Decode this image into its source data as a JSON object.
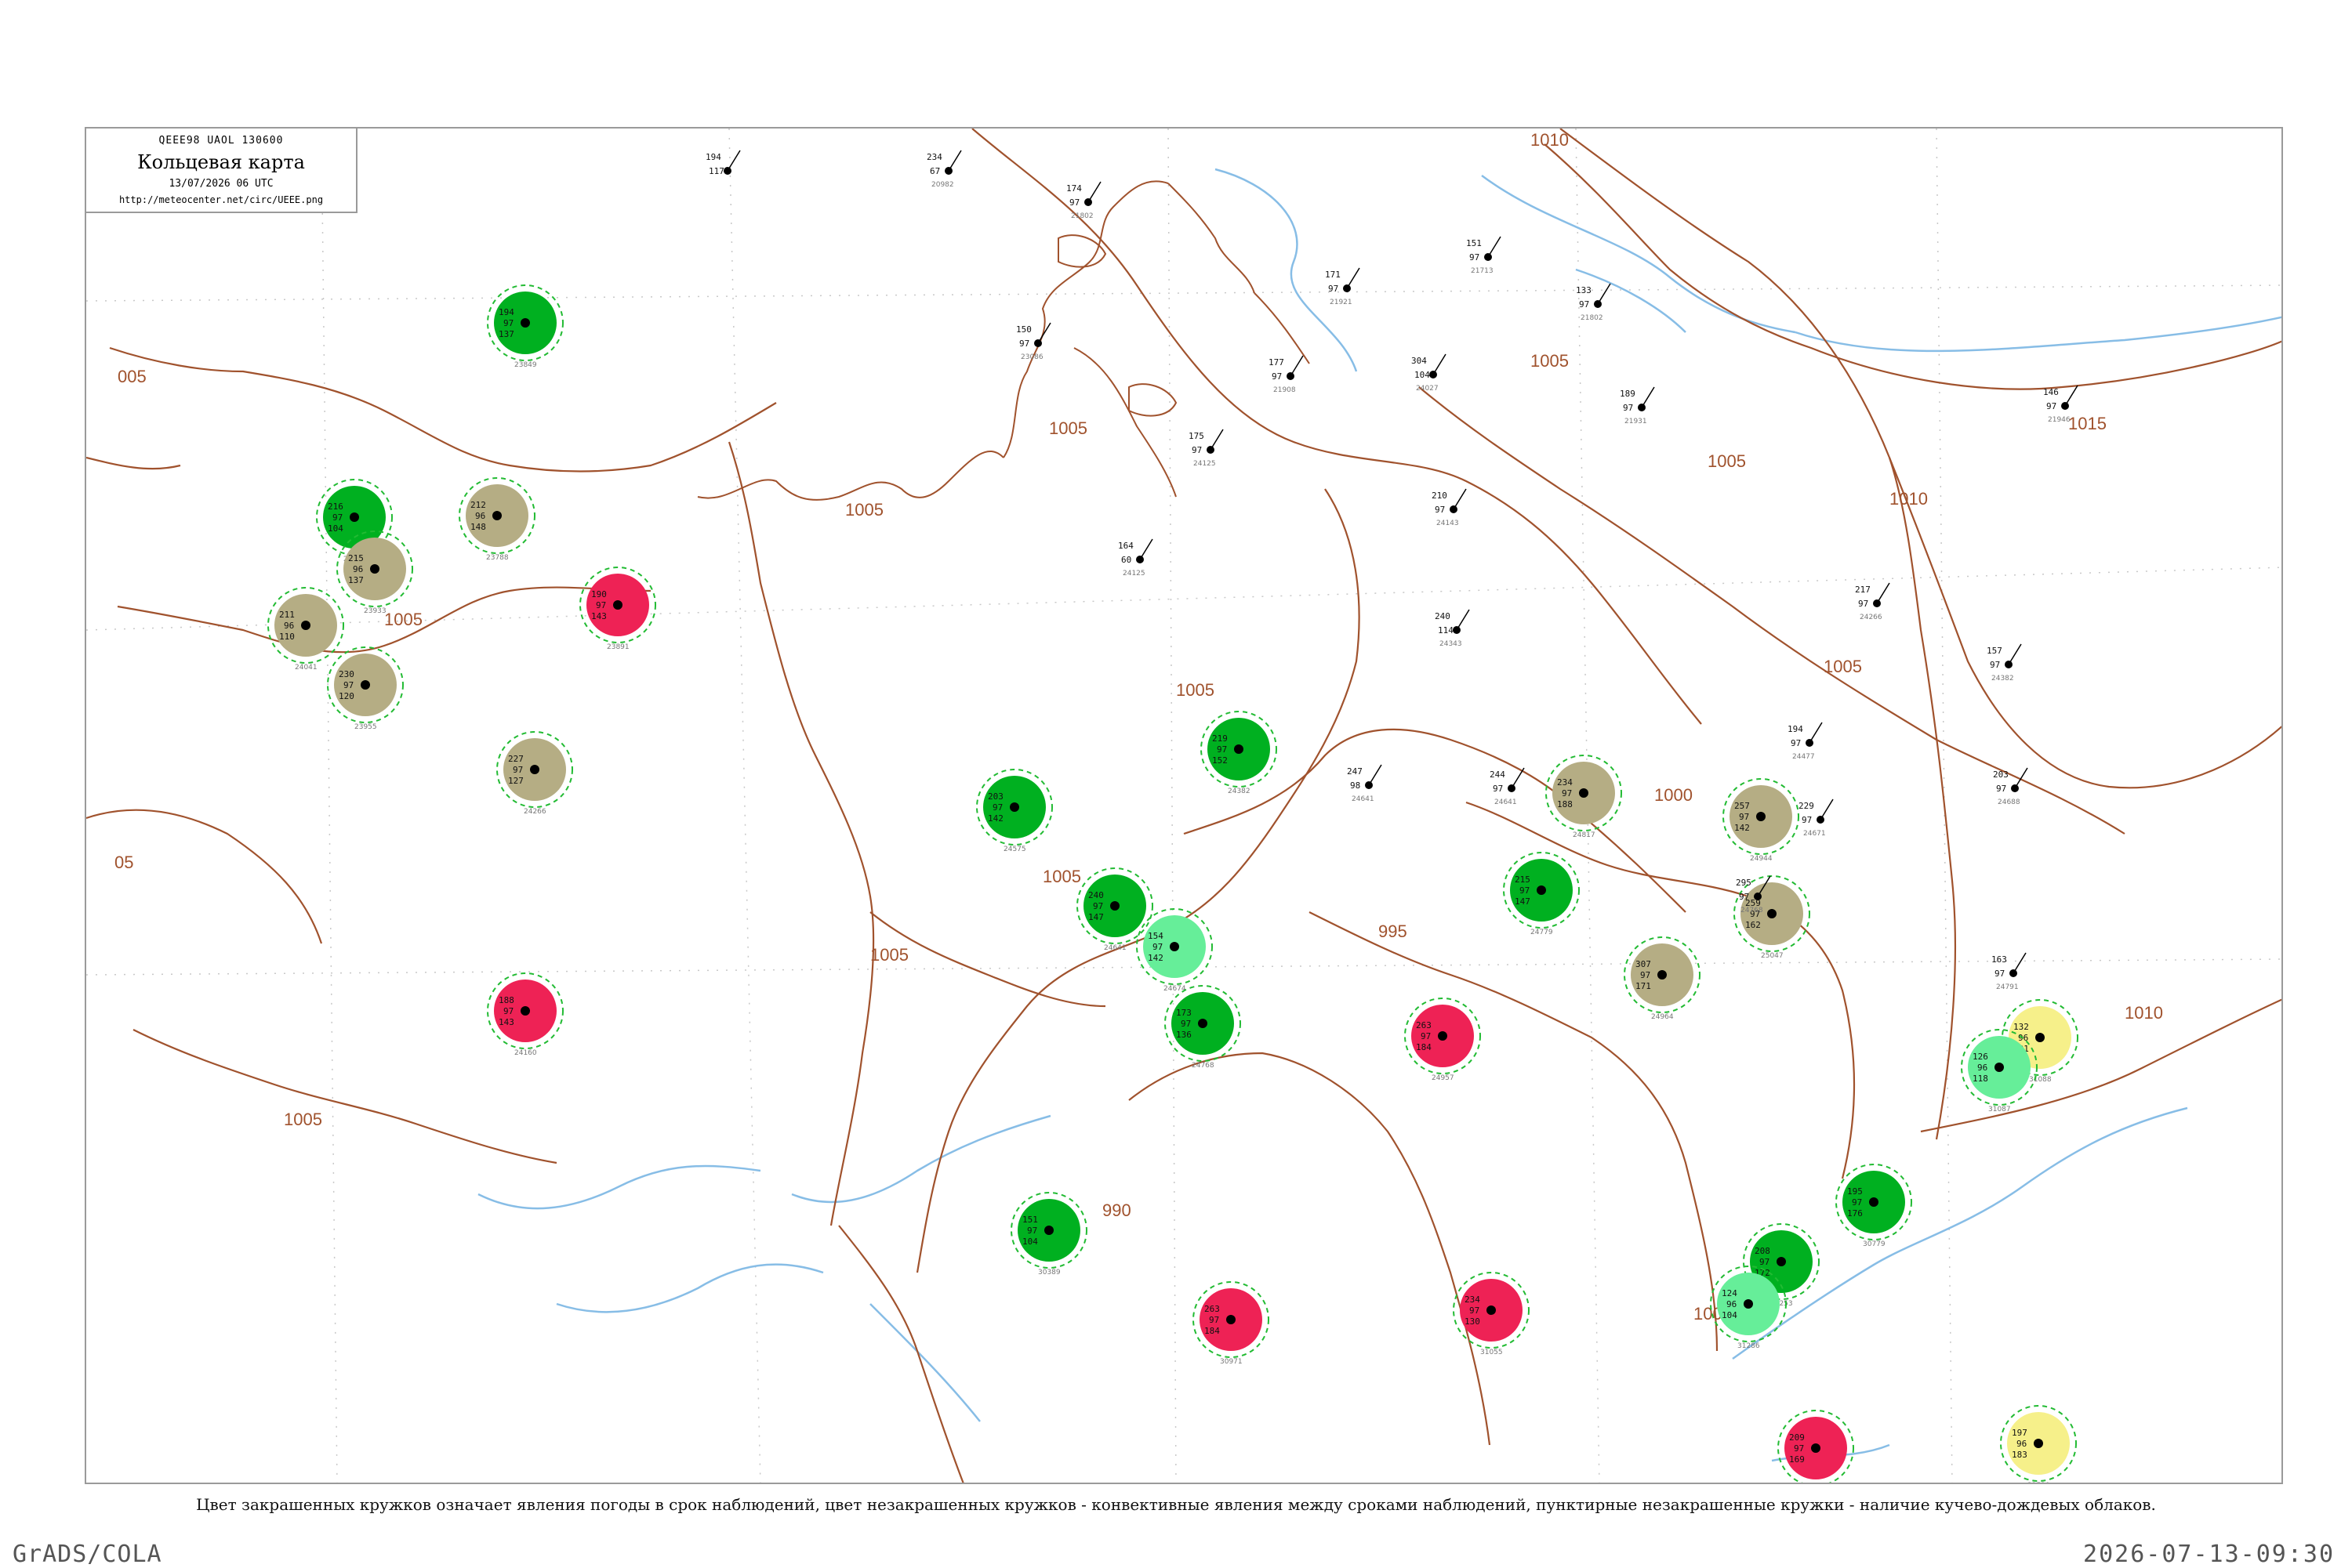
{
  "header": {
    "code": "QEEE98  UAOL  130600",
    "title": "Кольцевая карта",
    "date": "13/07/2026 06 UTC",
    "url": "http://meteocenter.net/circ/UEEE.png"
  },
  "caption": "Цвет закрашенных кружков означает явления погоды в срок наблюдений, цвет незакрашенных кружков - конвективные явления между сроками наблюдений, пунктирные незакрашенные кружки - наличие кучево-дождевых облаков.",
  "footer": {
    "left": "GrADS/COLA",
    "right": "2026-07-13-09:30"
  },
  "colors": {
    "isobar": "#a0522d",
    "coast": "#a0522d",
    "river": "#87bde6",
    "thunder_green": "#00b020",
    "shower_olive": "#b5ad84",
    "heavy_red": "#ee2255",
    "light_green": "#66ee99",
    "yellow": "#f6f08a",
    "cb_dash": "#22bb33"
  },
  "isobars": [
    {
      "label": "1010"
    },
    {
      "label": "1005"
    },
    {
      "label": "1005"
    },
    {
      "label": "1005"
    },
    {
      "label": "1005"
    },
    {
      "label": "1005"
    },
    {
      "label": "1005"
    },
    {
      "label": "1015"
    },
    {
      "label": "1010"
    },
    {
      "label": "1005"
    },
    {
      "label": "1000"
    },
    {
      "label": "995"
    },
    {
      "label": "990"
    },
    {
      "label": "1000"
    },
    {
      "label": "1010"
    },
    {
      "label": "1005"
    },
    {
      "label": "1005"
    },
    {
      "label": "1005"
    },
    {
      "label": "005"
    },
    {
      "label": "05"
    }
  ],
  "stations": [
    {
      "type": "green",
      "t": "194",
      "d": "97",
      "p": "137",
      "id": "23849"
    },
    {
      "type": "olive",
      "t": "212",
      "d": "96",
      "p": "148",
      "id": "23788"
    },
    {
      "type": "red",
      "t": "190",
      "d": "97",
      "p": "143",
      "id": "23891"
    },
    {
      "type": "green",
      "t": "216",
      "d": "97",
      "p": "104",
      "id": "23946"
    },
    {
      "type": "olive",
      "t": "215",
      "d": "96",
      "p": "137",
      "id": "23933"
    },
    {
      "type": "olive",
      "t": "211",
      "d": "96",
      "p": "110",
      "id": "24041"
    },
    {
      "type": "olive",
      "t": "230",
      "d": "97",
      "p": "120",
      "id": "23955"
    },
    {
      "type": "red",
      "t": "188",
      "d": "97",
      "p": "143",
      "id": "24160"
    },
    {
      "type": "olive",
      "t": "227",
      "d": "97",
      "p": "127",
      "id": "24266"
    },
    {
      "type": "green",
      "t": "219",
      "d": "97",
      "p": "152",
      "id": "24382"
    },
    {
      "type": "green",
      "t": "203",
      "d": "97",
      "p": "142",
      "id": "24575"
    },
    {
      "type": "green",
      "t": "240",
      "d": "97",
      "p": "147",
      "id": "24641"
    },
    {
      "type": "lightgreen",
      "t": "154",
      "d": "97",
      "p": "142",
      "id": "24674"
    },
    {
      "type": "green",
      "t": "173",
      "d": "97",
      "p": "136",
      "id": "24768"
    },
    {
      "type": "red",
      "t": "263",
      "d": "97",
      "p": "184",
      "id": "24957"
    },
    {
      "type": "olive",
      "t": "234",
      "d": "97",
      "p": "188",
      "id": "24817"
    },
    {
      "type": "olive",
      "t": "257",
      "d": "97",
      "p": "142",
      "id": "24944"
    },
    {
      "type": "olive",
      "t": "259",
      "d": "97",
      "p": "162",
      "id": "25047"
    },
    {
      "type": "green",
      "t": "215",
      "d": "97",
      "p": "147",
      "id": "24779"
    },
    {
      "type": "green",
      "t": "208",
      "d": "97",
      "p": "172",
      "id": "30253"
    },
    {
      "type": "red",
      "t": "209",
      "d": "97",
      "p": "169",
      "id": "31036"
    },
    {
      "type": "yellow",
      "t": "132",
      "d": "96",
      "p": "131",
      "id": "31088"
    },
    {
      "type": "lightgreen",
      "t": "126",
      "d": "96",
      "p": "118",
      "id": "31087"
    },
    {
      "type": "yellow",
      "t": "197",
      "d": "96",
      "p": "183",
      "id": "31510"
    },
    {
      "type": "green",
      "t": "195",
      "d": "97",
      "p": "176",
      "id": "30779"
    },
    {
      "type": "lightgreen",
      "t": "124",
      "d": "96",
      "p": "104",
      "id": "31286"
    },
    {
      "type": "red",
      "t": "263",
      "d": "97",
      "p": "184",
      "id": "30971"
    },
    {
      "type": "red",
      "t": "234",
      "d": "97",
      "p": "130",
      "id": "31055"
    },
    {
      "type": "green",
      "t": "151",
      "d": "97",
      "p": "104",
      "id": "30389"
    },
    {
      "type": "olive",
      "t": "307",
      "d": "97",
      "p": "171",
      "id": "24964"
    }
  ],
  "plain_stations": [
    {
      "t": "194",
      "d": "117",
      "id": ""
    },
    {
      "t": "234",
      "d": "67",
      "id": "20982"
    },
    {
      "t": "174",
      "d": "97",
      "id": "21802"
    },
    {
      "t": "171",
      "d": "97",
      "id": "21921"
    },
    {
      "t": "151",
      "d": "97",
      "id": "21713"
    },
    {
      "t": "133",
      "d": "97",
      "id": "21802"
    },
    {
      "t": "150",
      "d": "97",
      "id": "23086"
    },
    {
      "t": "177",
      "d": "97",
      "id": "21908"
    },
    {
      "t": "304",
      "d": "104",
      "id": "24027"
    },
    {
      "t": "189",
      "d": "97",
      "id": "21931"
    },
    {
      "t": "146",
      "d": "97",
      "id": "21946"
    },
    {
      "t": "175",
      "d": "97",
      "id": "24125"
    },
    {
      "t": "210",
      "d": "97",
      "id": "24143"
    },
    {
      "t": "164",
      "d": "60",
      "id": "24125"
    },
    {
      "t": "240",
      "d": "114",
      "id": "24343"
    },
    {
      "t": "217",
      "d": "97",
      "id": "24266"
    },
    {
      "t": "157",
      "d": "97",
      "id": "24382"
    },
    {
      "t": "194",
      "d": "97",
      "id": "24477"
    },
    {
      "t": "203",
      "d": "97",
      "id": "24688"
    },
    {
      "t": "244",
      "d": "97",
      "id": "24641"
    },
    {
      "t": "247",
      "d": "98",
      "id": "24641"
    },
    {
      "t": "229",
      "d": "97",
      "id": "24671"
    },
    {
      "t": "295",
      "d": "97",
      "id": "24768"
    },
    {
      "t": "163",
      "d": "97",
      "id": "24791"
    }
  ],
  "labels": {
    "grid_note": "1000"
  }
}
